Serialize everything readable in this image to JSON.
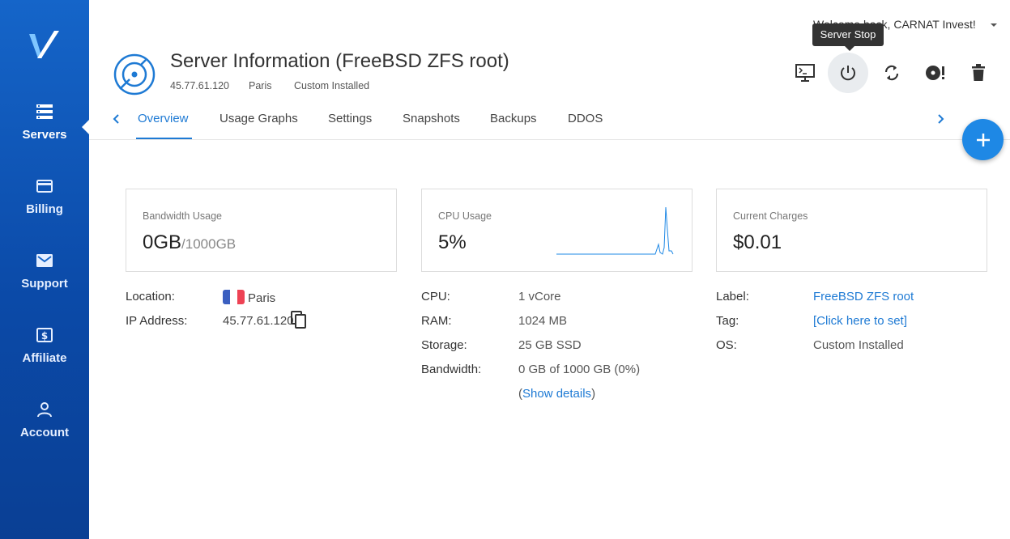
{
  "sidebar": {
    "items": [
      {
        "label": "Servers",
        "icon": "servers-icon"
      },
      {
        "label": "Billing",
        "icon": "billing-icon"
      },
      {
        "label": "Support",
        "icon": "mail-icon"
      },
      {
        "label": "Affiliate",
        "icon": "dollar-icon"
      },
      {
        "label": "Account",
        "icon": "user-icon"
      }
    ]
  },
  "header": {
    "welcome": "Welcome back, CARNAT Invest!",
    "tooltip": "Server Stop",
    "title": "Server Information (FreeBSD ZFS root)",
    "ip": "45.77.61.120",
    "location": "Paris",
    "os": "Custom Installed",
    "actions": [
      "console-icon",
      "power-icon",
      "restart-icon",
      "reinstall-icon",
      "trash-icon"
    ]
  },
  "tabs": [
    "Overview",
    "Usage Graphs",
    "Settings",
    "Snapshots",
    "Backups",
    "DDOS"
  ],
  "cards": {
    "bandwidth": {
      "label": "Bandwidth Usage",
      "value": "0GB",
      "unit": "/1000GB"
    },
    "cpu": {
      "label": "CPU Usage",
      "value": "5%"
    },
    "charges": {
      "label": "Current Charges",
      "value": "$0.01"
    }
  },
  "location_info": {
    "location_label": "Location:",
    "location_value": "Paris",
    "ip_label": "IP Address:",
    "ip_value": "45.77.61.120"
  },
  "specs": {
    "cpu_label": "CPU:",
    "cpu_value": "1 vCore",
    "ram_label": "RAM:",
    "ram_value": "1024 MB",
    "storage_label": "Storage:",
    "storage_value": "25 GB SSD",
    "bandwidth_label": "Bandwidth:",
    "bandwidth_value": "0 GB of 1000 GB (0%)",
    "show_details_open": "(",
    "show_details": "Show details",
    "show_details_close": ")"
  },
  "meta": {
    "label_label": "Label:",
    "label_value": "FreeBSD ZFS root",
    "tag_label": "Tag:",
    "tag_value": "[Click here to set]",
    "os_label": "OS:",
    "os_value": "Custom Installed"
  },
  "colors": {
    "accent": "#1e7ad4",
    "sidebar": "#1565c9",
    "fab": "#1e88e5"
  }
}
